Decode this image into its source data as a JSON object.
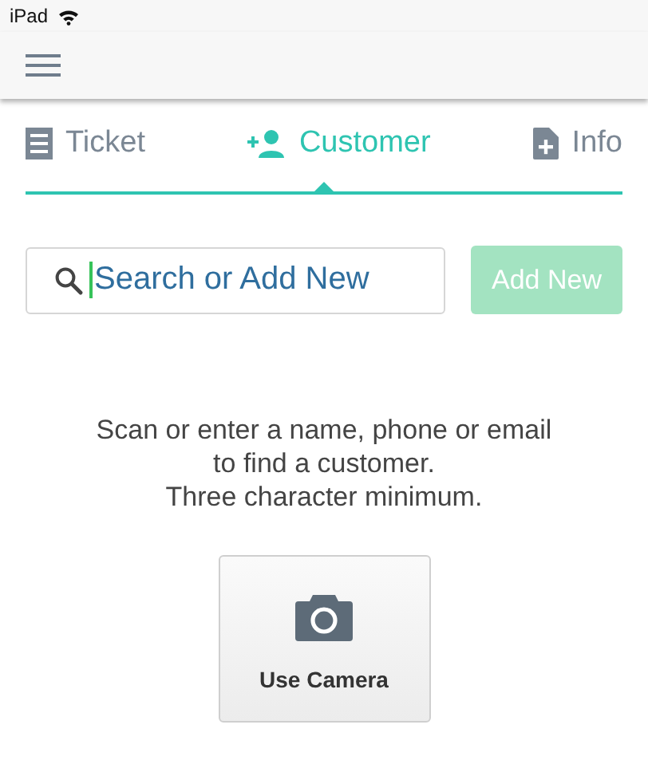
{
  "status_bar": {
    "device": "iPad"
  },
  "tabs": [
    {
      "label": "Ticket",
      "kind": "ticket",
      "selected": false
    },
    {
      "label": "Customer",
      "kind": "customer",
      "selected": true
    },
    {
      "label": "Info",
      "kind": "info",
      "selected": false
    }
  ],
  "search": {
    "placeholder": "Search or Add New"
  },
  "add_button": {
    "label": "Add New",
    "disabled": true
  },
  "message": [
    "Scan or enter a name, phone or email",
    "to find a customer.",
    "Three character minimum."
  ],
  "camera_button": {
    "label": "Use Camera"
  }
}
